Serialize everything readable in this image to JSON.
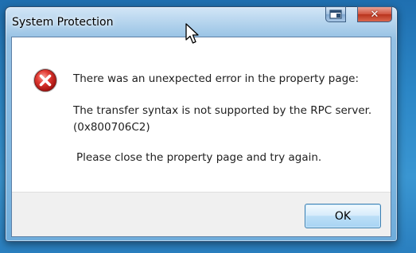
{
  "window": {
    "title": "System Protection"
  },
  "titlebar": {
    "help_icon": "help-pane-icon",
    "close_icon": "close-x-icon",
    "close_glyph": "✕"
  },
  "message": {
    "icon": "error-icon",
    "line1": "There was an unexpected error in the property page:",
    "line2": "The transfer syntax is not supported by the RPC server.",
    "line3": "(0x800706C2)",
    "line4": "Please close the property page and try again."
  },
  "buttons": {
    "ok_label": "OK"
  },
  "colors": {
    "error_red": "#d42a2a",
    "close_button": "#c9432d",
    "desktop": "#2b86c6"
  }
}
